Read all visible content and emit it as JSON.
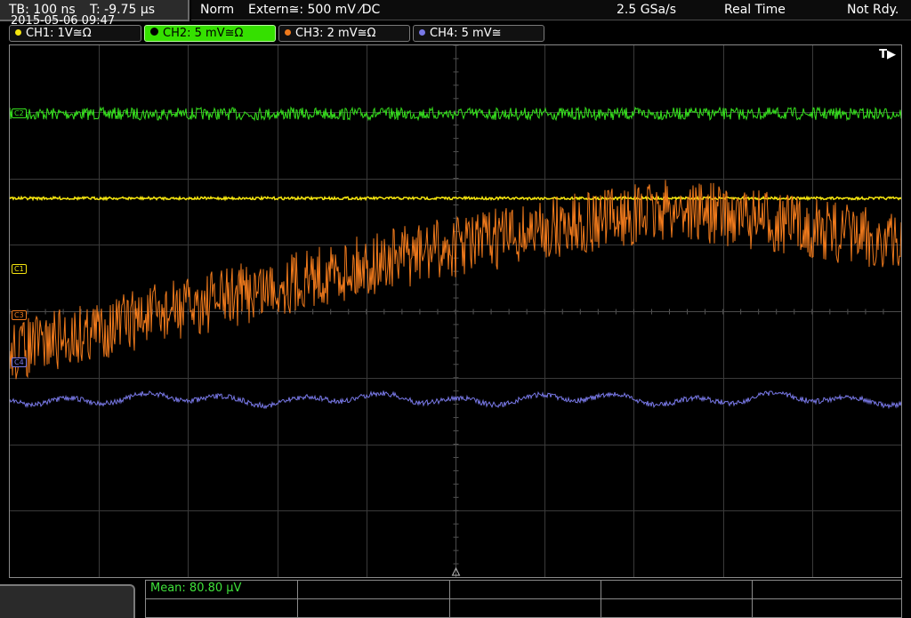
{
  "timebase": {
    "tb": "TB: 100 ns",
    "t": "T: -9.75 µs"
  },
  "status": {
    "mode": "Norm",
    "trigger": "Extern≅: 500 mV ⁄DC",
    "sample_rate": "2.5 GSa/s",
    "acq": "Real Time",
    "state": "Not Rdy."
  },
  "channels": [
    {
      "label": "CH1: 1V≅Ω",
      "color": "#f5e50f",
      "active": false
    },
    {
      "label": "CH2: 5 mV≅Ω",
      "color": "#37e21e",
      "active": true
    },
    {
      "label": "CH3: 2 mV≅Ω",
      "color": "#f07a1c",
      "active": false
    },
    {
      "label": "CH4: 5 mV≅",
      "color": "#7878e6",
      "active": false
    }
  ],
  "markers": {
    "trigger": "T▶",
    "c1": "C1",
    "c3": "C3",
    "c4": "C4",
    "c2": "C2"
  },
  "measurement": {
    "mean": "Mean: 80.80 µV"
  },
  "datetime": "2015-05-06 09:47",
  "colors": {
    "grid": "#3a3a3a",
    "frame": "#8a8a8a",
    "ch2_btn": "#35e000"
  }
}
